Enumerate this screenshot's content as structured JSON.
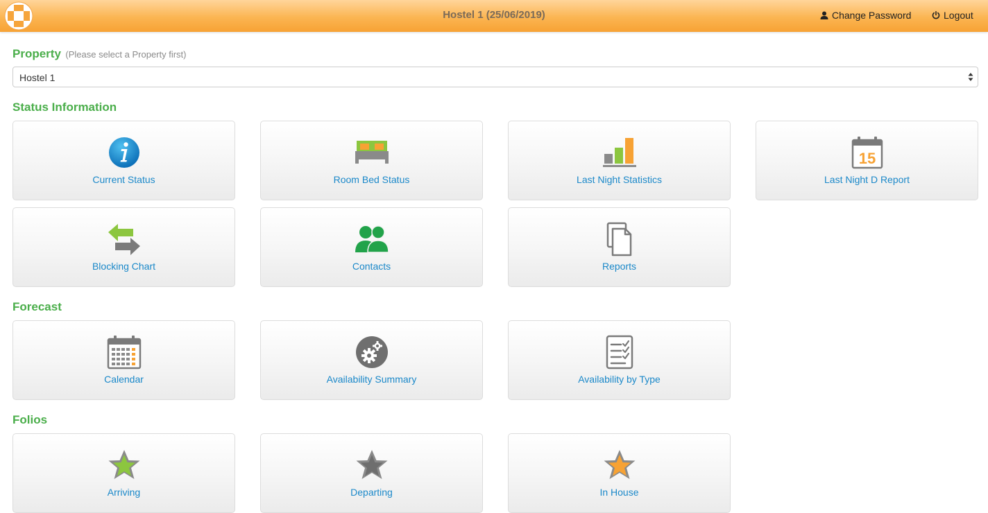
{
  "header": {
    "title": "Hostel 1 (25/06/2019)",
    "change_password": "Change Password",
    "logout": "Logout"
  },
  "property": {
    "heading": "Property",
    "hint": "(Please select a Property first)",
    "selected": "Hostel 1"
  },
  "sections": {
    "status": {
      "heading": "Status Information",
      "tiles": [
        {
          "label": "Current Status",
          "icon": "info-icon"
        },
        {
          "label": "Room Bed Status",
          "icon": "bed-icon"
        },
        {
          "label": "Last Night Statistics",
          "icon": "bar-chart-icon"
        },
        {
          "label": "Last Night D Report",
          "icon": "calendar-day-icon"
        },
        {
          "label": "Blocking Chart",
          "icon": "swap-arrows-icon"
        },
        {
          "label": "Contacts",
          "icon": "contacts-icon"
        },
        {
          "label": "Reports",
          "icon": "documents-icon"
        }
      ]
    },
    "forecast": {
      "heading": "Forecast",
      "tiles": [
        {
          "label": "Calendar",
          "icon": "calendar-icon"
        },
        {
          "label": "Availability Summary",
          "icon": "gears-icon"
        },
        {
          "label": "Availability by Type",
          "icon": "checklist-icon"
        }
      ]
    },
    "folios": {
      "heading": "Folios",
      "tiles": [
        {
          "label": "Arriving",
          "icon": "star-green-icon"
        },
        {
          "label": "Departing",
          "icon": "star-grey-icon"
        },
        {
          "label": "In House",
          "icon": "star-orange-icon"
        }
      ]
    }
  },
  "calendar_day": "15",
  "colors": {
    "accent_green": "#4aae4a",
    "link_blue": "#1a88c9",
    "header_orange": "#f7a234"
  }
}
